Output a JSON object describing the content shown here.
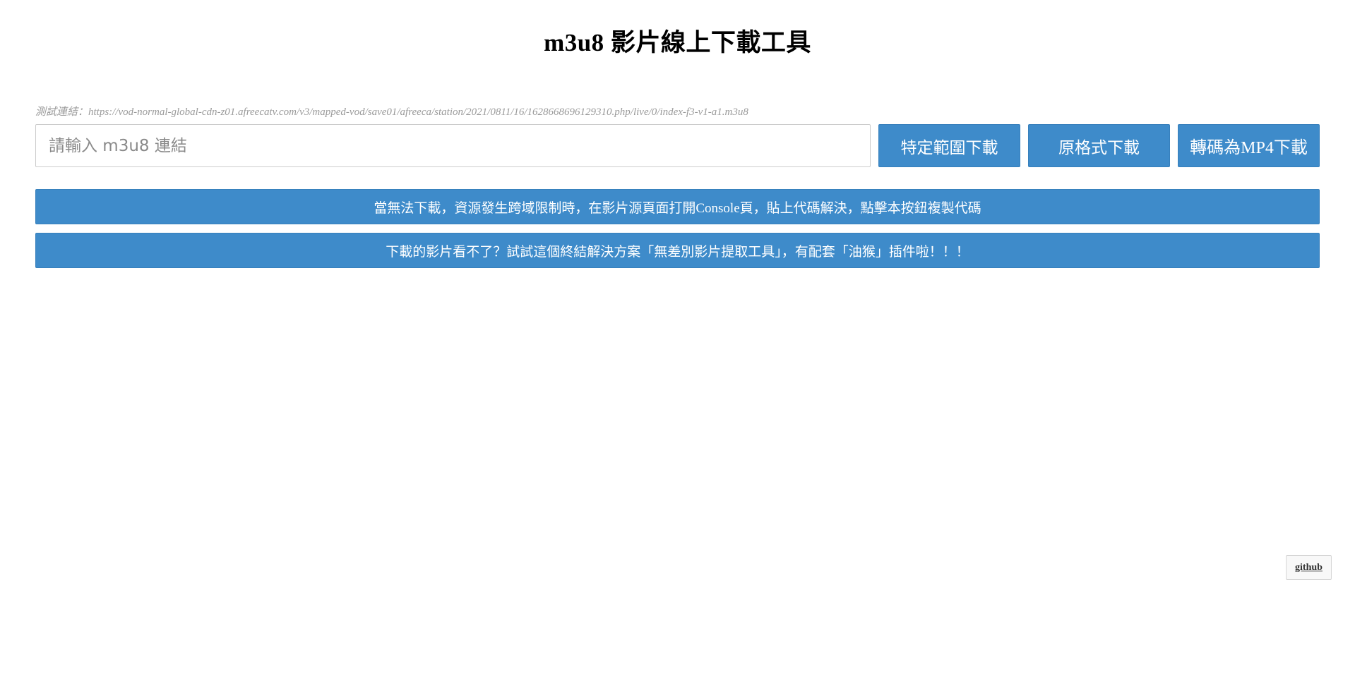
{
  "header": {
    "title": "m3u8 影片線上下載工具"
  },
  "test_link": {
    "text": "測試連結：https://vod-normal-global-cdn-z01.afreecatv.com/v3/mapped-vod/save01/afreeca/station/2021/0811/16/1628668696129310.php/live/0/index-f3-v1-a1.m3u8"
  },
  "url_input": {
    "placeholder": "請輸入 m3u8 連結",
    "value": ""
  },
  "buttons": {
    "range_download": "特定範圍下載",
    "original_download": "原格式下載",
    "mp4_download": "轉碼為MP4下載"
  },
  "notices": {
    "cors_copy_code": "當無法下載，資源發生跨域限制時，在影片源頁面打開Console頁，貼上代碼解決，點擊本按鈕複製代碼",
    "extractor_promo": "下載的影片看不了？試試這個終結解決方案「無差別影片提取工具」，有配套「油猴」插件啦！！！"
  },
  "footer": {
    "github_label": "github"
  },
  "colors": {
    "accent": "#3e8bca",
    "text_muted": "#9a9a9a",
    "border": "#cccccc"
  }
}
